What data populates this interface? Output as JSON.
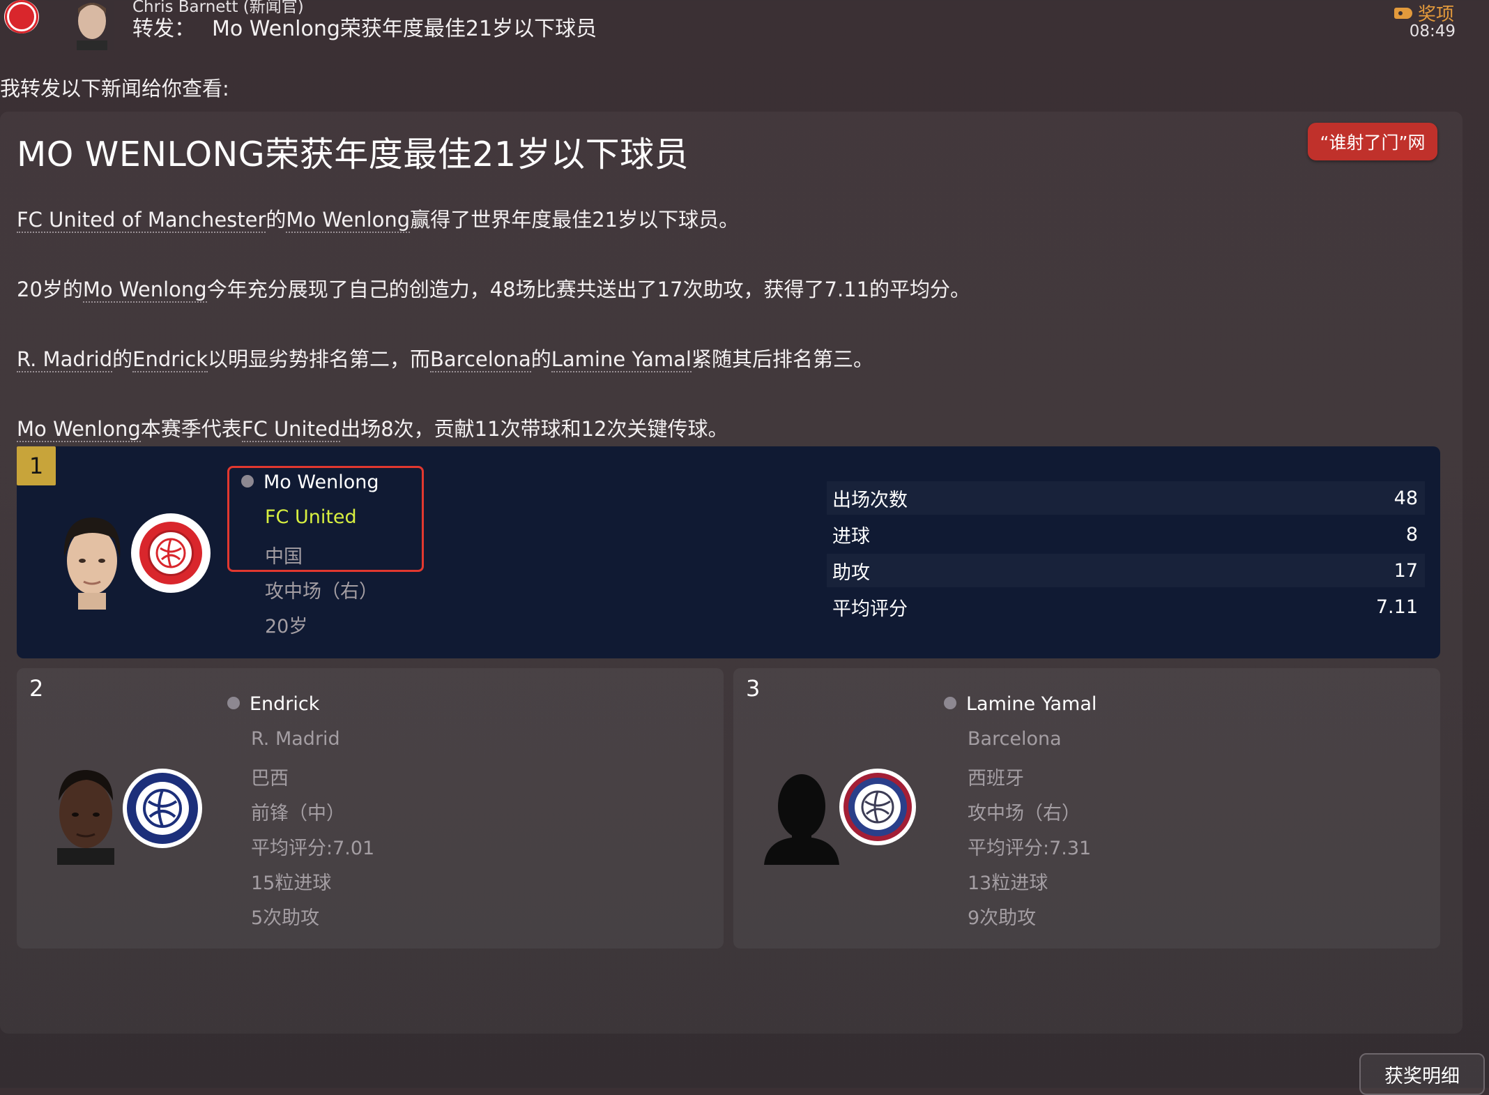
{
  "header": {
    "sender": "Chris Barnett (新闻官)",
    "subject_label": "转发：",
    "subject": "Mo Wenlong荣获年度最佳21岁以下球员",
    "tag": "奖项",
    "time": "08:49"
  },
  "intro": "我转发以下新闻给你查看:",
  "article": {
    "title": "MO WENLONG荣获年度最佳21岁以下球员",
    "source_button": "“谁射了门”网",
    "p1": {
      "club": "FC United of Manchester",
      "mid": "的",
      "player": "Mo Wenlong",
      "rest": "赢得了世界年度最佳21岁以下球员。"
    },
    "p2": {
      "pre": "20岁的",
      "player": "Mo Wenlong",
      "rest": "今年充分展现了自己的创造力，48场比赛共送出了17次助攻，获得了7.11的平均分。"
    },
    "p3": {
      "club1": "R. Madrid",
      "de1": "的",
      "player1": "Endrick",
      "mid": "以明显劣势排名第二，而",
      "club2": "Barcelona",
      "de2": "的",
      "player2": "Lamine Yamal",
      "rest": "紧随其后排名第三。"
    },
    "p4": {
      "player": "Mo Wenlong",
      "mid": "本赛季代表",
      "club": "FC United",
      "rest": "出场8次，贡献11次带球和12次关键传球。"
    }
  },
  "winner": {
    "rank": "1",
    "name": "Mo Wenlong",
    "club": "FC United",
    "nation": "中国",
    "position": "攻中场（右）",
    "age": "20岁",
    "club_color": "#d9262c",
    "stats": [
      {
        "label": "出场次数",
        "value": "48"
      },
      {
        "label": "进球",
        "value": "8"
      },
      {
        "label": "助攻",
        "value": "17"
      },
      {
        "label": "平均评分",
        "value": "7.11"
      }
    ]
  },
  "runners": [
    {
      "rank": "2",
      "name": "Endrick",
      "club": "R. Madrid",
      "nation": "巴西",
      "position": "前锋（中）",
      "rating": "平均评分:7.01",
      "goals": "15粒进球",
      "assists": "5次助攻"
    },
    {
      "rank": "3",
      "name": "Lamine Yamal",
      "club": "Barcelona",
      "nation": "西班牙",
      "position": "攻中场（右）",
      "rating": "平均评分:7.31",
      "goals": "13粒进球",
      "assists": "9次助攻"
    }
  ],
  "footer_button": "获奖明细"
}
